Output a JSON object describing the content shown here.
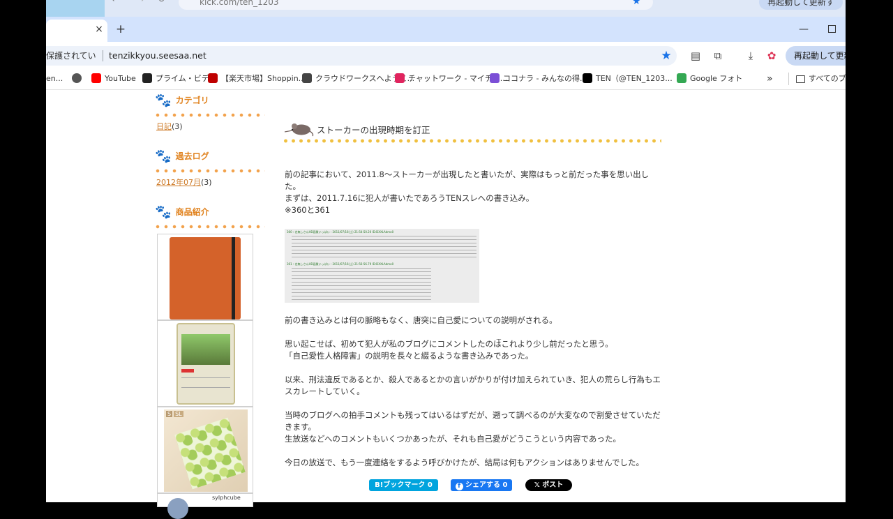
{
  "outer_browser": {
    "url": "kick.com/ten_1203",
    "restart_label": "再起動して更新す"
  },
  "browser": {
    "tab_close": "×",
    "new_tab": "+",
    "minimize": "—",
    "security_label": "保護されていない通信",
    "url": "tenzikkyou.seesaa.net",
    "restart_label": "再起動して更新す"
  },
  "bookmarks": [
    {
      "label": "en...",
      "icon": "page-icon",
      "color": "#888888"
    },
    {
      "label": "",
      "icon": "globe-icon",
      "color": "#555555"
    },
    {
      "label": "YouTube",
      "icon": "youtube-icon",
      "color": "#ff0000"
    },
    {
      "label": "プライム・ビデオ",
      "icon": "amazon-icon",
      "color": "#222222"
    },
    {
      "label": "【楽天市場】Shoppin...",
      "icon": "rakuten-icon",
      "color": "#bf0000"
    },
    {
      "label": "クラウドワークスへようこ...",
      "icon": "crowdworks-icon",
      "color": "#444444"
    },
    {
      "label": "チャットワーク - マイチャ...",
      "icon": "chatwork-icon",
      "color": "#e0245e"
    },
    {
      "label": "ココナラ - みんなの得...",
      "icon": "coconala-icon",
      "color": "#7b4fd6"
    },
    {
      "label": "TEN（@TEN_1203...",
      "icon": "x-icon",
      "color": "#000000"
    },
    {
      "label": "Google フォト",
      "icon": "google-photos-icon",
      "color": "#34a853"
    }
  ],
  "bookmarks_more": "»",
  "all_bookmarks": "すべてのブック",
  "sidebar": {
    "categories_heading": "カテゴリ",
    "category_link": "日記",
    "category_count": "(3)",
    "archive_heading": "過去ログ",
    "archive_link": "2012年07月",
    "archive_count": "(3)",
    "products_heading": "商品紹介",
    "product3_badges": [
      "S",
      "SL"
    ],
    "product4_text": "sylphcube"
  },
  "post": {
    "title": "ストーカーの出現時期を訂正",
    "paragraphs": [
      "前の記事において、2011.8〜ストーカーが出現したと書いたが、実際はもっと前だった事を思い出した。",
      "まずは、2011.7.16に犯人が書いたであろうTENスレへの書き込み。",
      "※360と361",
      "前の書き込みとは何の脈略もなく、唐突に自己愛についての説明がされる。",
      "思い起こせば、初めて犯人が私のブログにコメントしたのはこれより少し前だったと思う。",
      "「自己愛性人格障害」の説明を長々と綴るような書き込みであった。",
      "以来、刑法違反であるとか、殺人であるとかの言いがかりが付け加えられていき、犯人の荒らし行為もエスカレートしていく。",
      "当時のブログへの拍手コメントも残ってはいるはずだが、遡って調べるのが大変なので割愛させていただきます。",
      "生放送などへのコメントもいくつかあったが、それも自己愛がどうこうという内容であった。",
      "今日の放送で、もう一度連絡をするよう呼びかけたが、結局は何もアクションはありませんでした。"
    ],
    "screenshot_lines": [
      "360 : 名無しさんHD画質いっぱい : 2011/07/16(土) 21:54:50.20 ID:DXXLAdmo0",
      "361 : 名無しさんHD画質いっぱい : 2011/07/16(土) 21:56:56.79 ID:DXXLAdmo0"
    ]
  },
  "share": {
    "hatena": "B!ブックマーク",
    "hatena_count": "0",
    "facebook": "シェアする",
    "facebook_count": "0",
    "x": "ポスト"
  },
  "colors": {
    "accent_orange": "#e0801a",
    "link_orange": "#cc7722",
    "hatena_blue": "#00a4de",
    "facebook_blue": "#1877f2"
  }
}
